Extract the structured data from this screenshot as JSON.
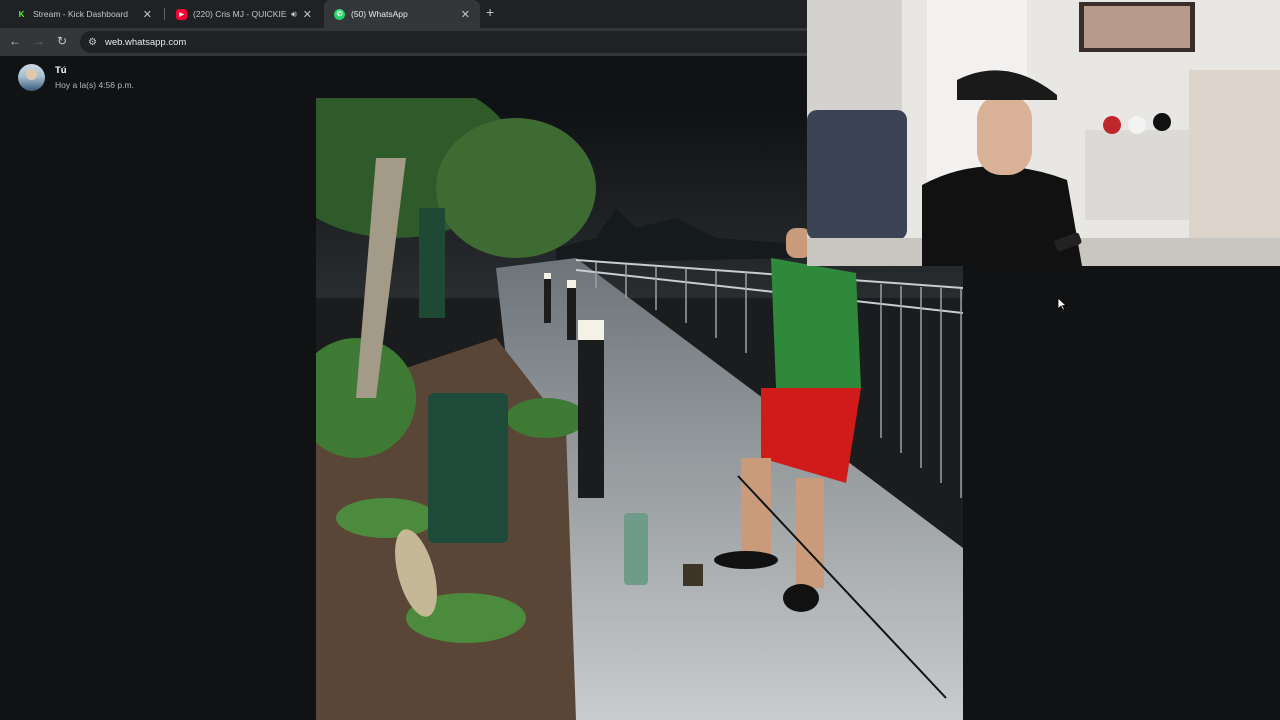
{
  "browser": {
    "tabs": [
      {
        "title": "Stream - Kick Dashboard",
        "icon": "kick-icon",
        "active": false
      },
      {
        "title": "(220) Cris MJ - QUICKIE (Vi",
        "icon": "youtube-icon",
        "active": false,
        "audio": true
      },
      {
        "title": "(50) WhatsApp",
        "icon": "whatsapp-icon",
        "active": true
      }
    ],
    "url": "web.whatsapp.com"
  },
  "message": {
    "sender": "Tú",
    "time": "Hoy a la(s) 4:56 p.m."
  },
  "colors": {
    "kick": "#53fc18",
    "youtube": "#ff0033",
    "whatsapp": "#25d366",
    "background": "#101213"
  }
}
